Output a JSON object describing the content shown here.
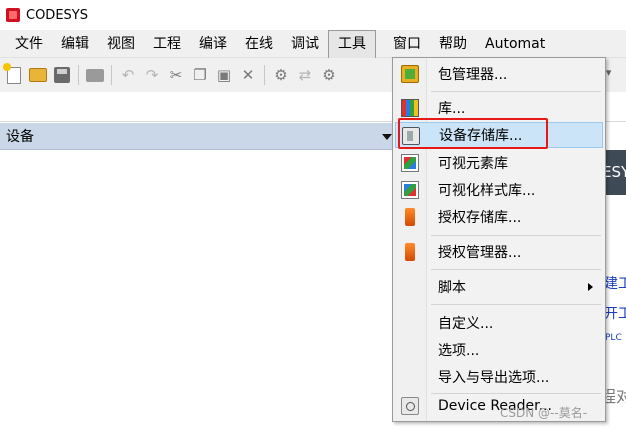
{
  "app": {
    "title": "CODESYS"
  },
  "menubar": {
    "items": [
      {
        "label": "文件"
      },
      {
        "label": "编辑"
      },
      {
        "label": "视图"
      },
      {
        "label": "工程"
      },
      {
        "label": "编译"
      },
      {
        "label": "在线"
      },
      {
        "label": "调试"
      },
      {
        "label": "工具"
      },
      {
        "label": "窗口"
      },
      {
        "label": "帮助"
      },
      {
        "label": "Automat"
      }
    ],
    "active": "工具"
  },
  "toolbar": {
    "icons": [
      "new-project-icon",
      "open-icon",
      "save-icon",
      "print-icon",
      "undo-icon",
      "redo-icon",
      "cut-icon",
      "copy-icon",
      "paste-icon",
      "delete-icon",
      "find-icon",
      "replace-icon",
      "find-next-icon"
    ]
  },
  "devices_panel": {
    "title": "设备"
  },
  "tools_menu": {
    "items": [
      {
        "label": "包管理器...",
        "icon": "package-manager-icon"
      },
      {
        "label": "库...",
        "icon": "library-icon"
      },
      {
        "label": "设备存储库...",
        "icon": "device-repository-icon",
        "highlighted": true
      },
      {
        "label": "可视元素库",
        "icon": "visual-element-library-icon"
      },
      {
        "label": "可视化样式库...",
        "icon": "visualization-style-library-icon"
      },
      {
        "label": "授权存储库...",
        "icon": "license-repository-icon"
      },
      {
        "label": "授权管理器...",
        "icon": "license-manager-icon"
      },
      {
        "label": "脚本",
        "has_submenu": true
      },
      {
        "label": "自定义..."
      },
      {
        "label": "选项..."
      },
      {
        "label": "导入与导出选项..."
      },
      {
        "label": "Device Reader...",
        "icon": "device-reader-icon"
      }
    ]
  },
  "start_page": {
    "banner": "ESY",
    "link1": "建工",
    "link2": "开工",
    "link3": "PLC",
    "heading": "程对"
  },
  "watermark": "CSDN @--莫名-"
}
